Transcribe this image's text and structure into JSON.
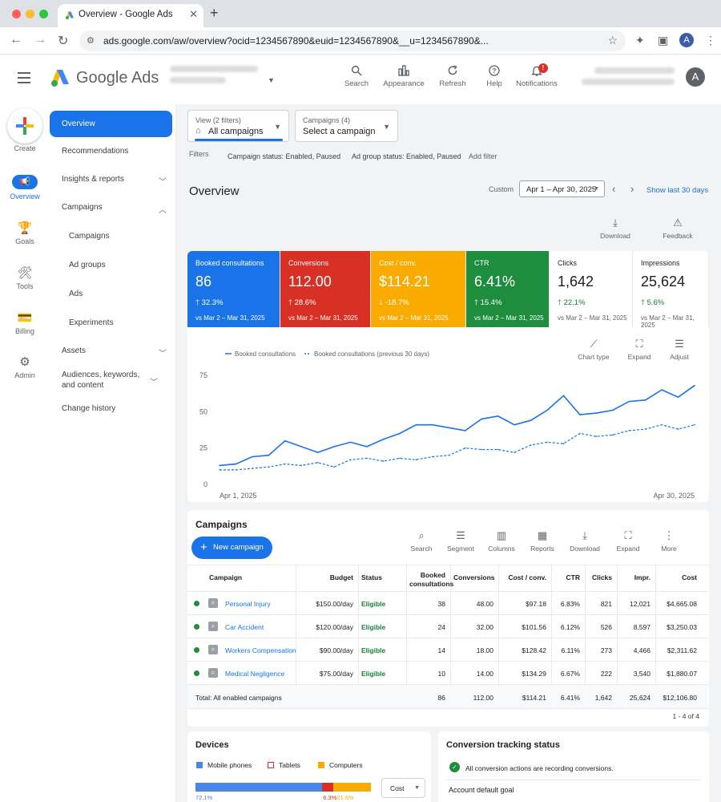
{
  "browser": {
    "tab_title": "Overview - Google Ads",
    "url": "ads.google.com/aw/overview?ocid=1234567890&euid=1234567890&__u=1234567890&...",
    "profile_letter": "A"
  },
  "header": {
    "brand": "Google Ads",
    "buttons": [
      {
        "label": "Search",
        "icon": "search-icon"
      },
      {
        "label": "Appearance",
        "icon": "appearance-icon"
      },
      {
        "label": "Refresh",
        "icon": "refresh-icon"
      },
      {
        "label": "Help",
        "icon": "help-icon"
      },
      {
        "label": "Notifications",
        "icon": "notifications-icon"
      }
    ],
    "avatar_letter": "A"
  },
  "rail": {
    "create": "Create",
    "items": [
      {
        "label": "Overview",
        "icon": "overview-icon"
      },
      {
        "label": "Goals",
        "icon": "goals-icon"
      },
      {
        "label": "Tools",
        "icon": "tools-icon"
      },
      {
        "label": "Billing",
        "icon": "billing-icon"
      },
      {
        "label": "Admin",
        "icon": "admin-icon"
      }
    ]
  },
  "nav": {
    "items": [
      {
        "label": "Overview"
      },
      {
        "label": "Recommendations"
      },
      {
        "label": "Insights & reports"
      },
      {
        "label": "Campaigns"
      },
      {
        "label": "Campaigns"
      },
      {
        "label": "Ad groups"
      },
      {
        "label": "Ads"
      },
      {
        "label": "Experiments"
      },
      {
        "label": "Assets"
      },
      {
        "label": "Audiences, keywords, and content"
      },
      {
        "label": "Change history"
      }
    ]
  },
  "filters": {
    "view_small": "View (2 filters)",
    "view_big": "All campaigns",
    "camp_small": "Campaigns (4)",
    "camp_big": "Select a campaign",
    "label": "Filters",
    "chips": [
      "Campaign status: Enabled, Paused",
      "Ad group status: Enabled, Paused"
    ],
    "add": "Add filter"
  },
  "overview": {
    "title": "Overview",
    "range_label": "Custom",
    "date_range": "Apr 1 – Apr 30, 2025",
    "show_last": "Show last 30 days",
    "download": "Download",
    "feedback": "Feedback"
  },
  "metrics": [
    {
      "label": "Booked consultations",
      "value": "86",
      "change": "32.3%",
      "dir": "up",
      "vs": "vs Mar 2 – Mar 31, 2025",
      "color": "#1a73e8"
    },
    {
      "label": "Conversions",
      "value": "112.00",
      "change": "28.6%",
      "dir": "up",
      "vs": "vs Mar 2 – Mar 31, 2025",
      "color": "#d93025"
    },
    {
      "label": "Cost / conv.",
      "value": "$114.21",
      "change": "-18.7%",
      "dir": "down",
      "vs": "vs Mar 2 – Mar 31, 2025",
      "color": "#f9ab00"
    },
    {
      "label": "CTR",
      "value": "6.41%",
      "change": "15.4%",
      "dir": "up",
      "vs": "vs Mar 2 – Mar 31, 2025",
      "color": "#1e8e3e"
    },
    {
      "label": "Clicks",
      "value": "1,642",
      "change": "22.1%",
      "dir": "up",
      "vs": "vs Mar 2 – Mar 31, 2025",
      "color": "#ffffff"
    },
    {
      "label": "Impressions",
      "value": "25,624",
      "change": "5.6%",
      "dir": "up",
      "vs": "vs Mar 2 – Mar 31, 2025",
      "color": "#ffffff"
    }
  ],
  "chart_controls": {
    "type": "Chart type",
    "expand": "Expand",
    "adjust": "Adjust"
  },
  "chart_data": {
    "type": "line",
    "x_labels": [
      "Apr 1, 2025",
      "Apr 30, 2025"
    ],
    "ylim": [
      0,
      75
    ],
    "yticks": [
      0,
      25,
      50,
      75
    ],
    "series": [
      {
        "name": "Booked consultations",
        "style": "solid",
        "values": [
          13,
          14,
          19,
          20,
          30,
          26,
          22,
          26,
          29,
          26,
          31,
          35,
          41,
          41,
          39,
          37,
          45,
          47,
          41,
          44,
          51,
          61,
          48,
          49,
          51,
          57,
          58,
          65,
          60,
          68
        ]
      },
      {
        "name": "Booked consultations (previous 30 days)",
        "style": "dashed",
        "values": [
          10,
          10,
          11,
          12,
          14,
          13,
          15,
          12,
          17,
          18,
          16,
          18,
          17,
          19,
          20,
          25,
          24,
          24,
          22,
          27,
          29,
          28,
          35,
          33,
          34,
          37,
          38,
          41,
          38,
          41
        ]
      }
    ]
  },
  "campaigns": {
    "title": "Campaigns",
    "new_button": "New campaign",
    "toolbar": [
      "Search",
      "Segment",
      "Columns",
      "Reports",
      "Download",
      "Expand",
      "More"
    ],
    "headers": [
      "Campaign",
      "Budget",
      "Status",
      "Booked consultations",
      "Conversions",
      "Cost / conv.",
      "CTR",
      "Clicks",
      "Impr.",
      "Cost"
    ],
    "rows": [
      [
        "Personal Injury",
        "$150.00/day",
        "Eligible",
        "38",
        "48.00",
        "$97.18",
        "6.83%",
        "821",
        "12,021",
        "$4,665.08"
      ],
      [
        "Car Accident",
        "$120.00/day",
        "Eligible",
        "24",
        "32.00",
        "$101.56",
        "6.12%",
        "526",
        "8,597",
        "$3,250.03"
      ],
      [
        "Workers Compensation",
        "$90.00/day",
        "Eligible",
        "14",
        "18.00",
        "$128.42",
        "6.11%",
        "273",
        "4,466",
        "$2,311.62"
      ],
      [
        "Medical Negligence",
        "$75.00/day",
        "Eligible",
        "10",
        "14.00",
        "$134.29",
        "6.67%",
        "222",
        "3,540",
        "$1,880.07"
      ]
    ],
    "total": [
      "Total: All enabled campaigns",
      "86",
      "112.00",
      "$114.21",
      "6.41%",
      "1,642",
      "25,624",
      "$12,106.80"
    ],
    "pagination": "1 - 4 of 4"
  },
  "devices": {
    "title": "Devices",
    "legend": [
      {
        "label": "Mobile phones",
        "color": "#4a86e8"
      },
      {
        "label": "Tablets",
        "color": "#d93025"
      },
      {
        "label": "Computers",
        "color": "#f9ab00"
      }
    ],
    "shares": [
      72.1,
      6.3,
      21.6
    ],
    "share_labels": [
      "72.1%",
      "6.3%",
      "21.6%"
    ],
    "dropdown": "Cost"
  },
  "conversion": {
    "title": "Conversion tracking status",
    "status": "All conversion actions are recording conversions.",
    "default_goal": "Account default goal"
  }
}
